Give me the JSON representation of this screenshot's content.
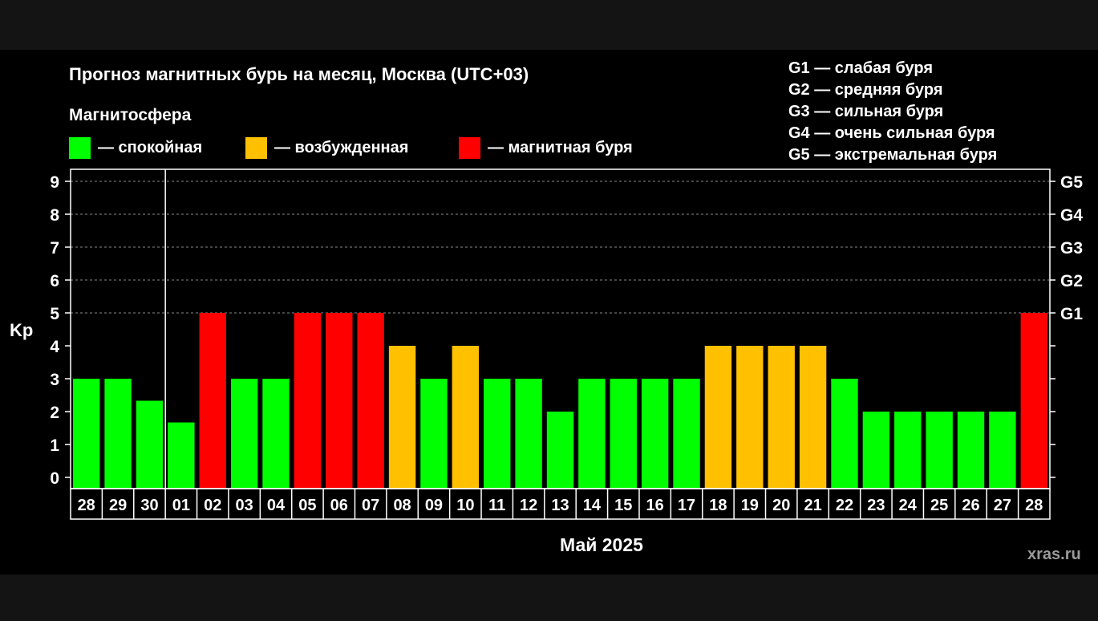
{
  "title": "Прогноз магнитных бурь на месяц, Москва (UTC+03)",
  "section_label": "Магнитосфера",
  "legend": [
    {
      "label": "— спокойная",
      "color": "#00ff00"
    },
    {
      "label": "— возбужденная",
      "color": "#ffc000"
    },
    {
      "label": "— магнитная буря",
      "color": "#ff0000"
    }
  ],
  "storm_levels": [
    "G1 — слабая буря",
    "G2 — средняя буря",
    "G3 — сильная буря",
    "G4 — очень сильная буря",
    "G5 — экстремальная буря"
  ],
  "watermark": "xras.ru",
  "chart_data": {
    "type": "bar",
    "title": "Прогноз магнитных бурь на месяц, Москва (UTC+03)",
    "ylabel": "Kp",
    "xlabel": "Май 2025",
    "ylim": [
      0,
      9
    ],
    "y_ticks": [
      "0",
      "1",
      "2",
      "3",
      "4",
      "5",
      "6",
      "7",
      "8",
      "9"
    ],
    "right_ticks": [
      {
        "value": 5,
        "label": "G1"
      },
      {
        "value": 6,
        "label": "G2"
      },
      {
        "value": 7,
        "label": "G3"
      },
      {
        "value": 8,
        "label": "G4"
      },
      {
        "value": 9,
        "label": "G5"
      }
    ],
    "categories": [
      "28",
      "29",
      "30",
      "01",
      "02",
      "03",
      "04",
      "05",
      "06",
      "07",
      "08",
      "09",
      "10",
      "11",
      "12",
      "13",
      "14",
      "15",
      "16",
      "17",
      "18",
      "19",
      "20",
      "21",
      "22",
      "23",
      "24",
      "25",
      "26",
      "27",
      "28"
    ],
    "values": [
      3,
      3,
      2.33,
      1.67,
      5,
      3,
      3,
      5,
      5,
      5,
      4,
      3,
      4,
      3,
      3,
      2,
      3,
      3,
      3,
      3,
      4,
      4,
      4,
      4,
      3,
      2,
      2,
      2,
      2,
      2,
      5
    ],
    "colors": [
      "#00ff00",
      "#00ff00",
      "#00ff00",
      "#00ff00",
      "#ff0000",
      "#00ff00",
      "#00ff00",
      "#ff0000",
      "#ff0000",
      "#ff0000",
      "#ffc000",
      "#00ff00",
      "#ffc000",
      "#00ff00",
      "#00ff00",
      "#00ff00",
      "#00ff00",
      "#00ff00",
      "#00ff00",
      "#00ff00",
      "#ffc000",
      "#ffc000",
      "#ffc000",
      "#ffc000",
      "#00ff00",
      "#00ff00",
      "#00ff00",
      "#00ff00",
      "#00ff00",
      "#00ff00",
      "#ff0000"
    ],
    "month_divider_after_index": 2,
    "grid": "dashed horizontal at Kp 5-9"
  }
}
